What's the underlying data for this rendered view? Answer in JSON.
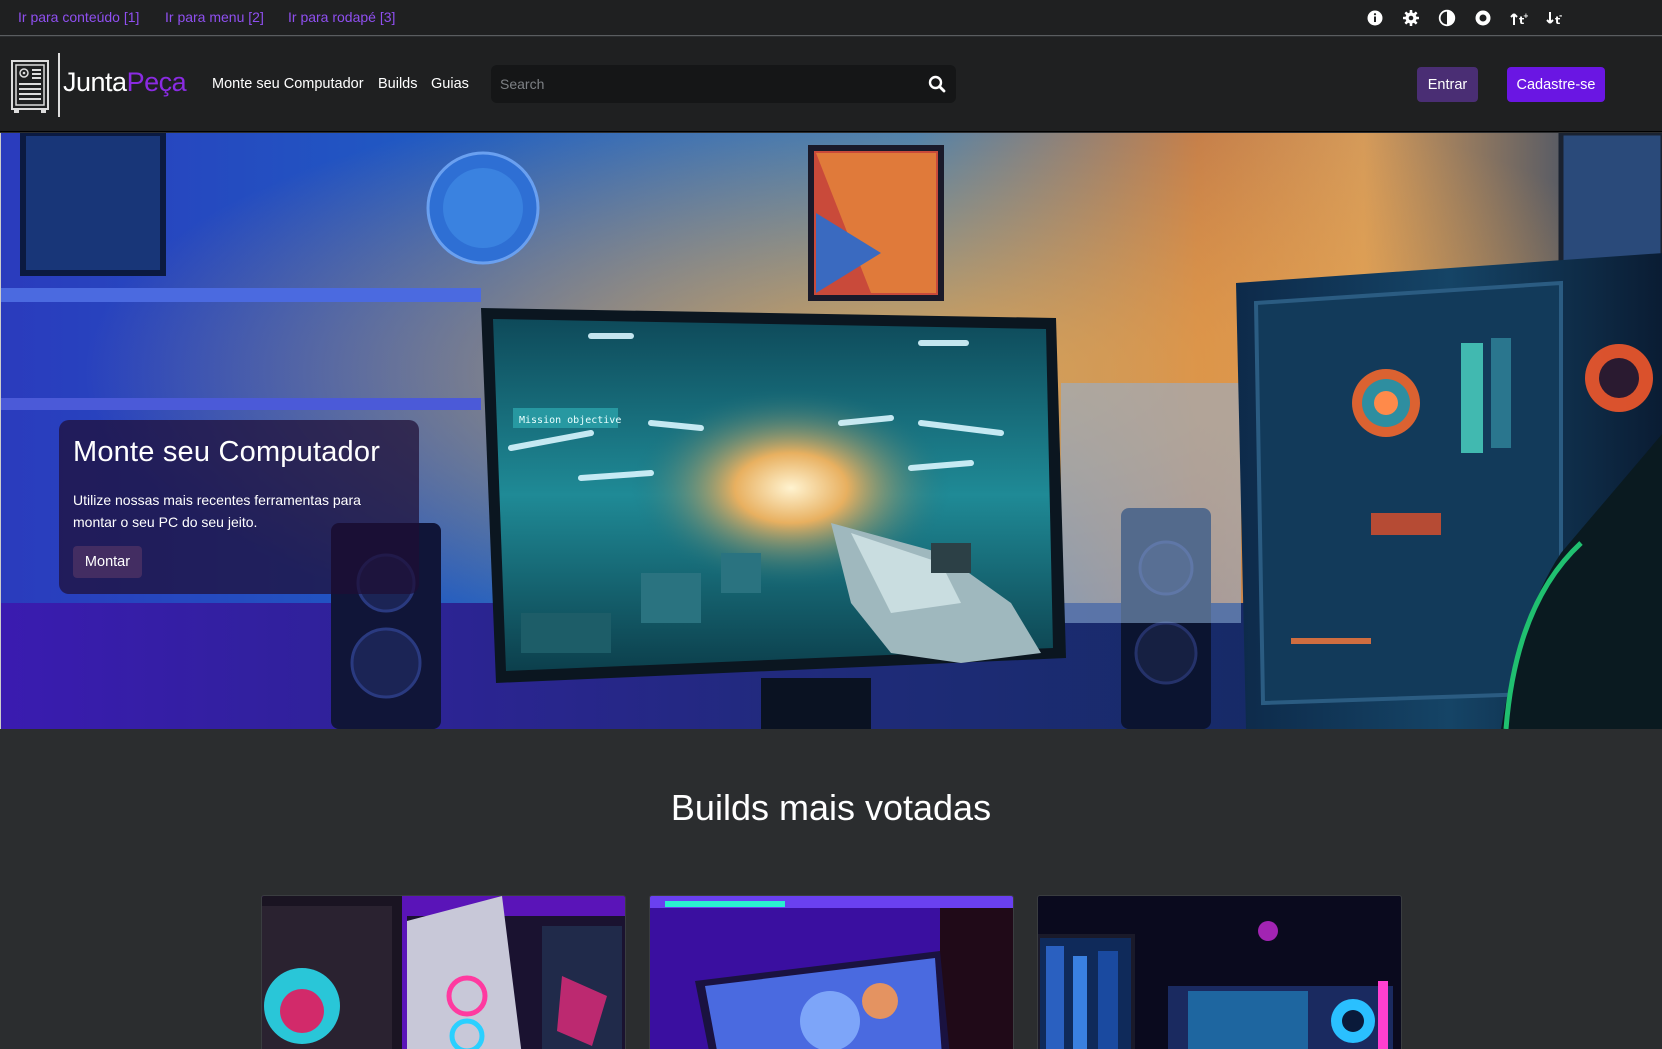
{
  "skip_links": [
    {
      "label": "Ir para conteúdo [1]"
    },
    {
      "label": "Ir para menu [2]"
    },
    {
      "label": "Ir para rodapé [3]"
    }
  ],
  "a11y_icons": [
    "info-icon",
    "gear-icon",
    "contrast-icon",
    "circle-stop-icon",
    "font-increase-icon",
    "font-decrease-icon"
  ],
  "brand": {
    "word1": "Junta",
    "word2": "Peça",
    "accent": "#8a2be2"
  },
  "nav": {
    "items": [
      {
        "label": "Monte seu Computador"
      },
      {
        "label": "Builds"
      },
      {
        "label": "Guias"
      }
    ]
  },
  "search": {
    "placeholder": "Search"
  },
  "auth": {
    "login_label": "Entrar",
    "signup_label": "Cadastre-se"
  },
  "hero": {
    "title": "Monte seu Computador",
    "description": "Utilize nossas mais recentes ferramentas para montar o seu PC do seu jeito.",
    "button_label": "Montar",
    "screen_text": "Mission objective"
  },
  "builds_section": {
    "title": "Builds mais votadas",
    "cards": [
      {
        "image": "pc-build-1"
      },
      {
        "image": "pc-build-2"
      },
      {
        "image": "pc-build-3"
      }
    ]
  },
  "colors": {
    "primary": "#6a16e3",
    "secondary": "#4a2e74",
    "link": "#8f4ff0",
    "background": "#2b2d2f"
  }
}
